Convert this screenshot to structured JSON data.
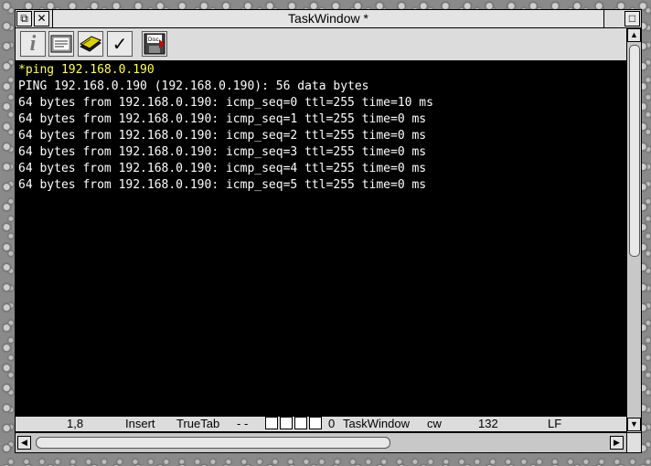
{
  "window": {
    "title": "TaskWindow *",
    "back_icon": "back-icon",
    "close_icon": "close-icon",
    "toggle_size_icon": "toggle-size-icon"
  },
  "toolbar": {
    "tools": [
      {
        "name": "info-icon",
        "glyph": "i"
      },
      {
        "name": "link-icon",
        "glyph": "⇄"
      },
      {
        "name": "book-icon",
        "glyph": "▬"
      },
      {
        "name": "tick-icon",
        "glyph": "✓"
      },
      {
        "name": "disc-save-icon",
        "glyph": "Disc"
      }
    ]
  },
  "terminal": {
    "command": "*ping 192.168.0.190",
    "lines": [
      "PING 192.168.0.190 (192.168.0.190): 56 data bytes",
      "64 bytes from 192.168.0.190: icmp_seq=0 ttl=255 time=10 ms",
      "64 bytes from 192.168.0.190: icmp_seq=1 ttl=255 time=0 ms",
      "64 bytes from 192.168.0.190: icmp_seq=2 ttl=255 time=0 ms",
      "64 bytes from 192.168.0.190: icmp_seq=3 ttl=255 time=0 ms",
      "64 bytes from 192.168.0.190: icmp_seq=4 ttl=255 time=0 ms",
      "64 bytes from 192.168.0.190: icmp_seq=5 ttl=255 time=0 ms"
    ]
  },
  "status": {
    "position": "1,8",
    "mode": "Insert",
    "tab": "TrueTab",
    "flags": "- -",
    "count": "0",
    "task": "TaskWindow",
    "extra": "cw",
    "width": "132",
    "line_ending": "LF"
  },
  "colors": {
    "terminal_bg": "#000000",
    "terminal_text": "#ffffff",
    "command_text": "#ffff55"
  }
}
